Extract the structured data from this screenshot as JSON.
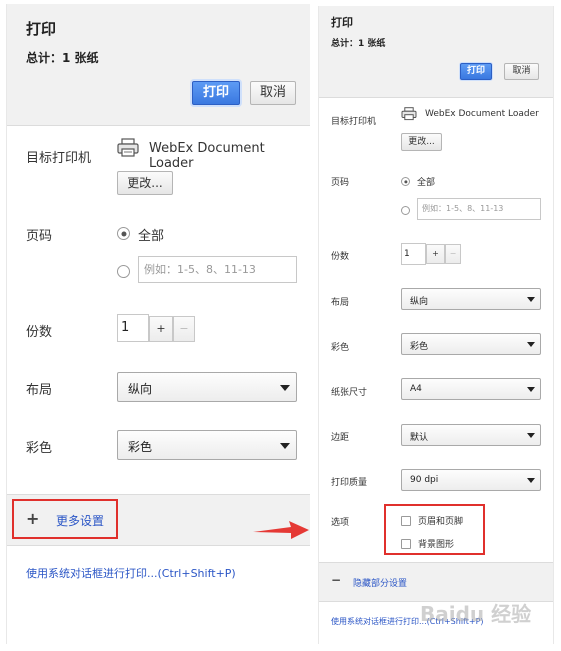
{
  "left": {
    "title": "打印",
    "total": "总计：1 张纸",
    "print_button": "打印",
    "cancel_button": "取消",
    "printer_label": "目标打印机",
    "printer_name": "WebEx Document Loader",
    "change_button": "更改...",
    "pages_label": "页码",
    "pages_all": "全部",
    "pages_placeholder": "例如：1-5、8、11-13",
    "copies_label": "份数",
    "copies_value": "1",
    "plus": "+",
    "minus": "−",
    "layout_label": "布局",
    "layout_value": "纵向",
    "color_label": "彩色",
    "color_value": "彩色",
    "more_settings": "更多设置",
    "more_settings_icon": "+",
    "system_dialog_link": "使用系统对话框进行打印...(Ctrl+Shift+P)"
  },
  "right": {
    "title": "打印",
    "total": "总计：1 张纸",
    "print_button": "打印",
    "cancel_button": "取消",
    "printer_label": "目标打印机",
    "printer_name": "WebEx Document Loader",
    "change_button": "更改...",
    "pages_label": "页码",
    "pages_all": "全部",
    "pages_placeholder": "例如：1-5、8、11-13",
    "copies_label": "份数",
    "copies_value": "1",
    "plus": "+",
    "minus": "−",
    "layout_label": "布局",
    "layout_value": "纵向",
    "color_label": "彩色",
    "color_value": "彩色",
    "paper_label": "纸张尺寸",
    "paper_value": "A4",
    "margin_label": "边距",
    "margin_value": "默认",
    "quality_label": "打印质量",
    "quality_value": "90 dpi",
    "options_label": "选项",
    "option_header_footer": "页眉和页脚",
    "option_background": "背景图形",
    "hide_settings": "隐藏部分设置",
    "hide_settings_icon": "−",
    "system_dialog_link": "使用系统对话框进行打印...(Ctrl+Shift+P)"
  },
  "watermark": "Baidu 经验",
  "colors": {
    "primary": "#3a78e0",
    "link": "#2b56c6",
    "highlight": "#e0302c",
    "header_bg": "#f1f1f1"
  },
  "icons": {
    "printer": "printer-icon",
    "arrow": "arrow-right-icon"
  }
}
